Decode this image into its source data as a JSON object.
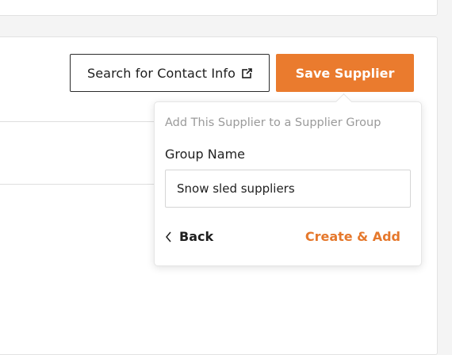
{
  "toolbar": {
    "search_contact_label": "Search for Contact Info",
    "save_supplier_label": "Save Supplier"
  },
  "group_popover": {
    "heading": "Add This Supplier to a Supplier Group",
    "field_label": "Group Name",
    "group_name_value": "Snow sled suppliers",
    "back_label": "Back",
    "create_add_label": "Create & Add"
  },
  "icons": {
    "external_link": "external-link-icon",
    "back_chevron": "chevron-left-icon"
  },
  "colors": {
    "accent": "#ea7b2e",
    "accent_text": "#e5782c",
    "muted_text": "#9a9a9a"
  }
}
